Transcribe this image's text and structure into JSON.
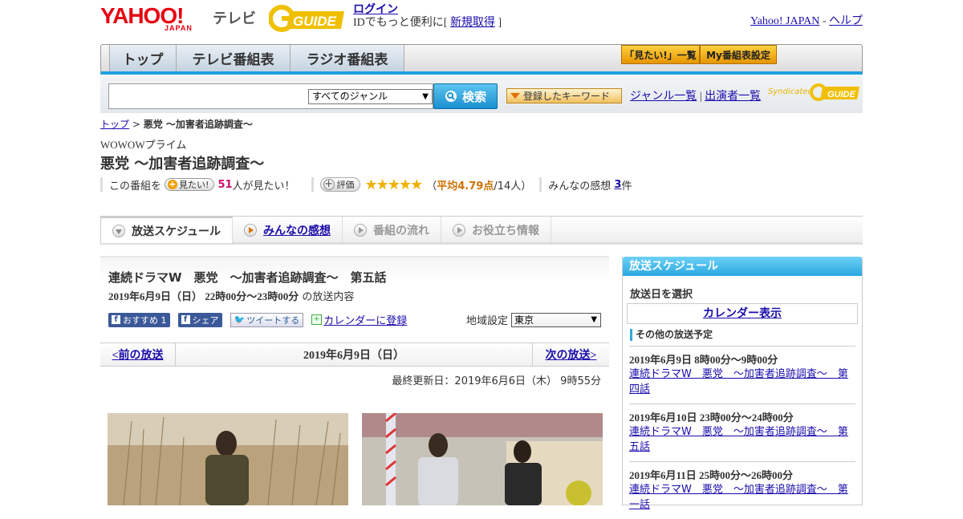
{
  "header": {
    "yahoo": "YAHOO!",
    "yahoo_japan": "JAPAN",
    "tv": "テレビ",
    "gguide": "GUIDE",
    "login": "ログイン",
    "login_sub_prefix": "IDでもっと便利に[",
    "signup": "新規取得",
    "login_sub_suffix": "]",
    "yahoo_japan_link": "Yahoo! JAPAN",
    "separator": "-",
    "help": "ヘルプ"
  },
  "nav": {
    "tabs": [
      "トップ",
      "テレビ番組表",
      "ラジオ番組表"
    ],
    "mitai_list": "「見たい!」一覧",
    "my_schedule": "My番組表設定"
  },
  "search": {
    "genre": "すべてのジャンル",
    "button": "検索",
    "keyword_button": "登録したキーワード",
    "genre_list": "ジャンル一覧",
    "divider": "|",
    "cast_list": "出演者一覧",
    "syndicated": "Syndicated",
    "syndicated_logo": "GUIDE"
  },
  "breadcrumb": {
    "top": "トップ",
    "sep": ">",
    "current": "悪党 ～加害者追跡調査～"
  },
  "program": {
    "station": "WOWOWプライム",
    "title": "悪党 ～加害者追跡調査～",
    "stats_prefix": "この番組を",
    "mitai_btn": "見たい!",
    "mitai_count": "51",
    "mitai_suffix": "人が見たい！",
    "hyoka_btn": "評価",
    "rating_stars": 4.79,
    "rating_open": "（",
    "rating_label": "平均4.79点",
    "rating_count": "/14人）",
    "impressions_prefix": "みんなの感想",
    "impressions_count": "3",
    "impressions_suffix": "件"
  },
  "subtabs": [
    "放送スケジュール",
    "みんなの感想",
    "番組の流れ",
    "お役立ち情報"
  ],
  "episode": {
    "title": "連続ドラマW　悪党　～加害者追跡調査～　第五話",
    "date": "2019年6月9日（日）  22時00分～23時00分",
    "date_suffix": "の放送内容",
    "fb_recommend": "おすすめ 1",
    "fb_share": "シェア",
    "tweet": "ツイートする",
    "calendar": "カレンダーに登録",
    "area_label": "地域設定",
    "area_value": "東京",
    "prev": "<前の放送",
    "current_date": "2019年6月9日（日）",
    "next": "次の放送>",
    "updated": "最終更新日：2019年6月6日（木）  9時55分"
  },
  "sidebar": {
    "title": "放送スケジュール",
    "select_date": "放送日を選択",
    "calendar": "カレンダー表示",
    "other_head": "その他の放送予定",
    "items": [
      {
        "date": "2019年6月9日  8時00分～9時00分",
        "title": "連続ドラマW　悪党　～加害者追跡調査～　第四話"
      },
      {
        "date": "2019年6月10日  23時00分～24時00分",
        "title": "連続ドラマW　悪党　～加害者追跡調査～　第五話"
      },
      {
        "date": "2019年6月11日  25時00分～26時00分",
        "title": "連続ドラマW　悪党　～加害者追跡調査～　第一話"
      }
    ]
  },
  "colors": {
    "accent_blue": "#1ea0e0",
    "yahoo_red": "#e60012",
    "gguide_yellow": "#f0c000"
  }
}
